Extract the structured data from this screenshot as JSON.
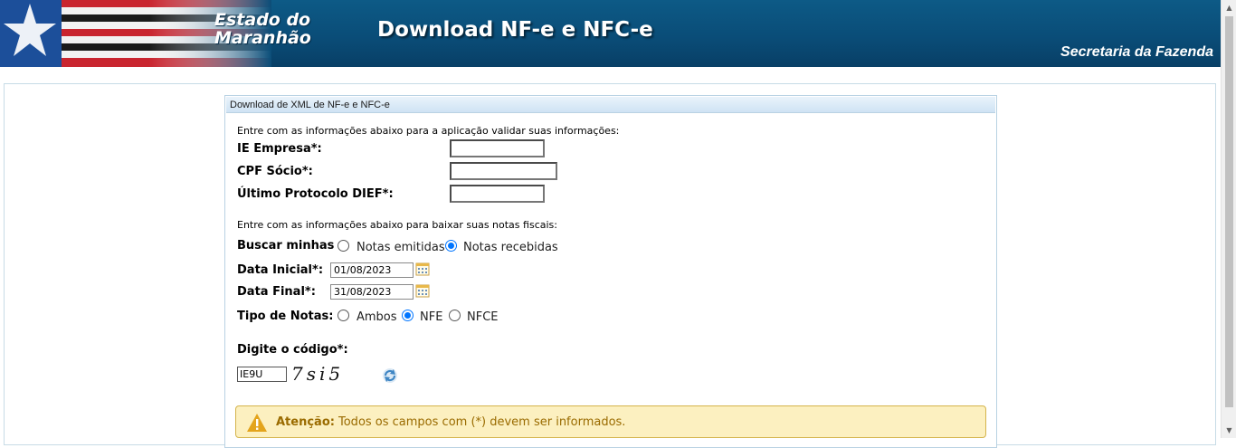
{
  "header": {
    "state_line1": "Estado do",
    "state_line2": "Maranhão",
    "title": "Download NF-e e NFC-e",
    "department": "Secretaria da Fazenda"
  },
  "panel": {
    "title": "Download de XML de NF-e e NFC-e",
    "validate_intro": "Entre com as informações abaixo para a aplicação validar suas informações:",
    "ie_label": "IE Empresa*:",
    "ie_value": "",
    "cpf_label": "CPF Sócio*:",
    "cpf_value": "",
    "protocol_label": "Último Protocolo DIEF*:",
    "protocol_value": "",
    "download_intro": "Entre com as informações abaixo para baixar suas notas fiscais:",
    "search_label": "Buscar minhas",
    "search_options": [
      {
        "label": "Notas emitidas",
        "checked": false
      },
      {
        "label": "Notas recebidas",
        "checked": true
      }
    ],
    "start_date_label": "Data Inicial*:",
    "start_date_value": "01/08/2023",
    "end_date_label": "Data Final*:",
    "end_date_value": "31/08/2023",
    "type_label": "Tipo de Notas:",
    "type_options": [
      {
        "label": "Ambos",
        "checked": false
      },
      {
        "label": "NFE",
        "checked": true
      },
      {
        "label": "NFCE",
        "checked": false
      }
    ],
    "code_label": "Digite o código*:",
    "code_value": "IE9U",
    "captcha_text": "7si5"
  },
  "alert": {
    "title": "Atenção:",
    "message": "Todos os campos com (*) devem ser informados."
  },
  "icons": {
    "calendar": "calendar-icon",
    "refresh": "refresh-icon",
    "warning": "warning-icon"
  },
  "colors": {
    "banner": "#0a4d78",
    "panel_border": "#b9d2e3",
    "radio_accent": "#0075ff",
    "alert_bg": "#fcf0c0",
    "alert_text": "#9a6b00"
  }
}
